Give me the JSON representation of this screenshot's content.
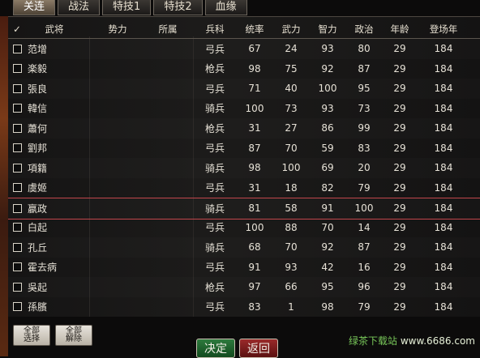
{
  "tabs": [
    "关连",
    "战法",
    "特技1",
    "特技2",
    "血缘"
  ],
  "columns": [
    "武将",
    "势力",
    "所属",
    "兵科",
    "统率",
    "武力",
    "智力",
    "政治",
    "年龄",
    "登场年"
  ],
  "rows": [
    {
      "name": "范增",
      "unit": "弓兵",
      "lead": "67",
      "war": "24",
      "int": "93",
      "pol": "80",
      "age": "29",
      "year": "184"
    },
    {
      "name": "楽毅",
      "unit": "枪兵",
      "lead": "98",
      "war": "75",
      "int": "92",
      "pol": "87",
      "age": "29",
      "year": "184"
    },
    {
      "name": "張良",
      "unit": "弓兵",
      "lead": "71",
      "war": "40",
      "int": "100",
      "pol": "95",
      "age": "29",
      "year": "184"
    },
    {
      "name": "韓信",
      "unit": "骑兵",
      "lead": "100",
      "war": "73",
      "int": "93",
      "pol": "73",
      "age": "29",
      "year": "184"
    },
    {
      "name": "蕭何",
      "unit": "枪兵",
      "lead": "31",
      "war": "27",
      "int": "86",
      "pol": "99",
      "age": "29",
      "year": "184"
    },
    {
      "name": "劉邦",
      "unit": "弓兵",
      "lead": "87",
      "war": "70",
      "int": "59",
      "pol": "83",
      "age": "29",
      "year": "184"
    },
    {
      "name": "項籍",
      "unit": "骑兵",
      "lead": "98",
      "war": "100",
      "int": "69",
      "pol": "20",
      "age": "29",
      "year": "184"
    },
    {
      "name": "虞姬",
      "unit": "弓兵",
      "lead": "31",
      "war": "18",
      "int": "82",
      "pol": "79",
      "age": "29",
      "year": "184"
    },
    {
      "name": "嬴政",
      "unit": "骑兵",
      "lead": "81",
      "war": "58",
      "int": "91",
      "pol": "100",
      "age": "29",
      "year": "184"
    },
    {
      "name": "白起",
      "unit": "弓兵",
      "lead": "100",
      "war": "88",
      "int": "70",
      "pol": "14",
      "age": "29",
      "year": "184"
    },
    {
      "name": "孔丘",
      "unit": "骑兵",
      "lead": "68",
      "war": "70",
      "int": "92",
      "pol": "87",
      "age": "29",
      "year": "184"
    },
    {
      "name": "霍去病",
      "unit": "弓兵",
      "lead": "91",
      "war": "93",
      "int": "42",
      "pol": "16",
      "age": "29",
      "year": "184"
    },
    {
      "name": "吳起",
      "unit": "枪兵",
      "lead": "97",
      "war": "66",
      "int": "95",
      "pol": "96",
      "age": "29",
      "year": "184"
    },
    {
      "name": "孫臏",
      "unit": "弓兵",
      "lead": "83",
      "war": "1",
      "int": "98",
      "pol": "79",
      "age": "29",
      "year": "184"
    }
  ],
  "selected_row": 8,
  "buttons": {
    "select_all": "全部\n选择",
    "clear_all": "全部\n解除",
    "ok": "决定",
    "back": "返回"
  },
  "watermark": {
    "brand": "绿茶下载站",
    "url": "www.6686.com"
  },
  "colors": {
    "selected": "#7a1820",
    "accent": "#2d7a3d"
  }
}
